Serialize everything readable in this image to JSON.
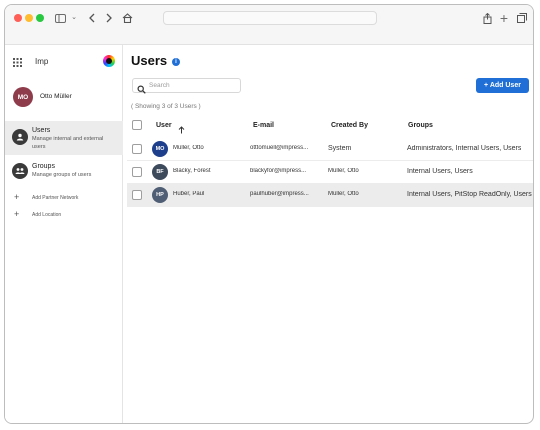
{
  "browser": {
    "traffic_lights": [
      "#ff5f57",
      "#febc2e",
      "#28c840"
    ],
    "icons": [
      "sidebar-toggle-icon",
      "chevron-down-icon",
      "back-icon",
      "forward-icon",
      "home-icon",
      "share-icon",
      "new-tab-icon",
      "tabs-overview-icon"
    ]
  },
  "sidebar": {
    "app_name": "Imp",
    "profile": {
      "initials": "MO",
      "name": "Otto Müller",
      "color": "#8e3b4b"
    },
    "nav": [
      {
        "title": "Users",
        "subtitle": "Manage internal and external users",
        "icon": "user-icon",
        "active": true
      },
      {
        "title": "Groups",
        "subtitle": "Manage groups of users",
        "icon": "group-icon",
        "active": false
      }
    ],
    "links": [
      {
        "label": "Add Partner Network",
        "icon": "plus-icon"
      },
      {
        "label": "Add Location",
        "icon": "plus-icon"
      }
    ]
  },
  "main": {
    "title": "Users",
    "add_button": "+ Add User",
    "search_placeholder": "Search",
    "showing": "( Showing 3 of 3 Users )",
    "columns": [
      "User",
      "E-mail",
      "Created By",
      "Groups"
    ],
    "sort_icon": "arrow-up-icon",
    "rows": [
      {
        "initials": "MO",
        "avatar_color": "#1e3f8c",
        "name": "Müller, Otto",
        "email": "otttomuell@impress...",
        "created_by": "System",
        "groups": "Administrators, Internal Users, Users",
        "selected": false
      },
      {
        "initials": "BF",
        "avatar_color": "#3d4a5c",
        "name": "Blacky, Forest",
        "email": "blackyfor@impress...",
        "created_by": "Müller, Otto",
        "groups": "Internal Users, Users",
        "selected": false
      },
      {
        "initials": "HP",
        "avatar_color": "#4f5e74",
        "name": "Huber, Paul",
        "email": "paulhuber@impress...",
        "created_by": "Müller, Otto",
        "groups": "Internal Users, PitStop ReadOnly, Users",
        "selected": true
      }
    ]
  },
  "colors": {
    "accent": "#1f6fd6",
    "selected_row": "#ececec",
    "active_nav": "#ececec"
  }
}
